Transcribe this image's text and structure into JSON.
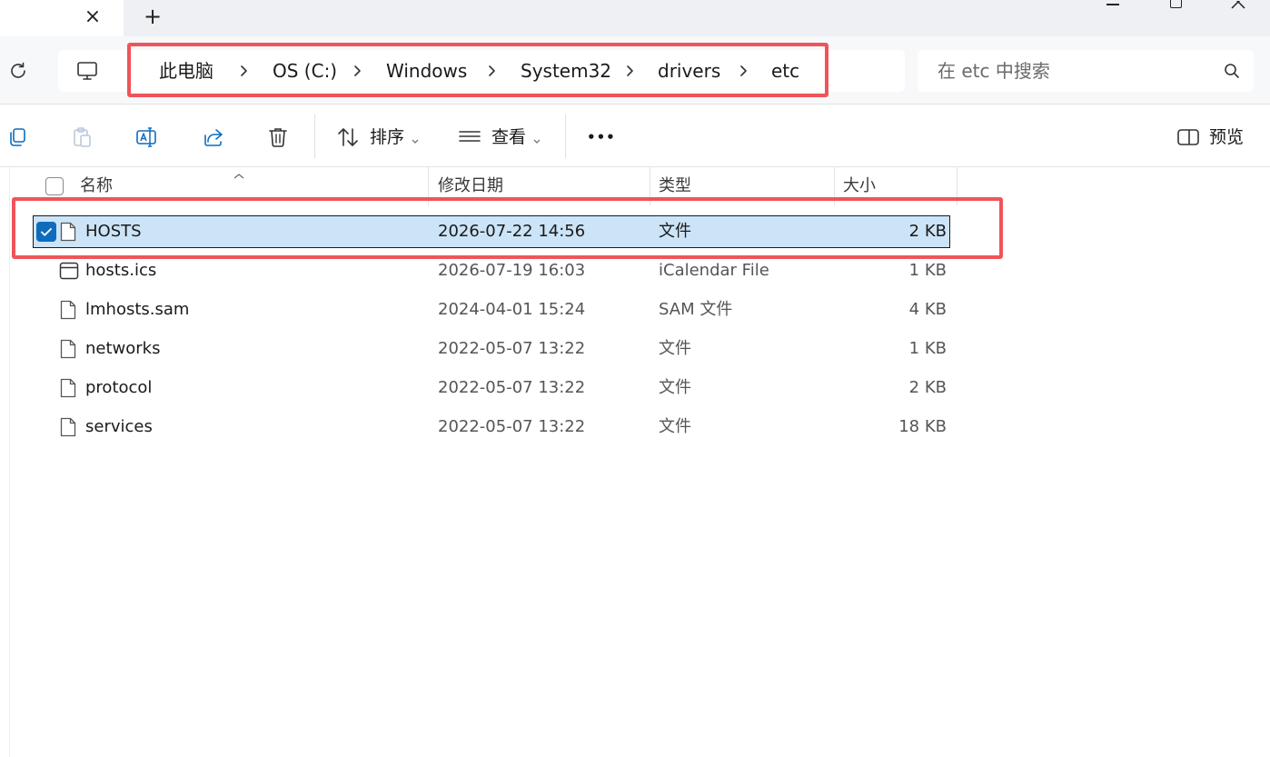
{
  "window": {
    "new_tab_symbol": "+",
    "close_tab_symbol": "×"
  },
  "address": {
    "breadcrumbs": [
      "此电脑",
      "OS (C:)",
      "Windows",
      "System32",
      "drivers",
      "etc"
    ],
    "search_placeholder": "在 etc 中搜索"
  },
  "toolbar": {
    "sort_label": "排序",
    "view_label": "查看",
    "more_label": "•••",
    "preview_label": "预览"
  },
  "columns": {
    "name": "名称",
    "modified": "修改日期",
    "type": "类型",
    "size": "大小"
  },
  "files": [
    {
      "name": "HOSTS",
      "modified": "2026-07-22 14:56",
      "type": "文件",
      "size": "2 KB",
      "icon": "file-icon",
      "selected": true
    },
    {
      "name": "hosts.ics",
      "modified": "2026-07-19 16:03",
      "type": "iCalendar File",
      "size": "1 KB",
      "icon": "calendar-file-icon",
      "selected": false
    },
    {
      "name": "lmhosts.sam",
      "modified": "2024-04-01 15:24",
      "type": "SAM 文件",
      "size": "4 KB",
      "icon": "file-icon",
      "selected": false
    },
    {
      "name": "networks",
      "modified": "2022-05-07 13:22",
      "type": "文件",
      "size": "1 KB",
      "icon": "file-icon",
      "selected": false
    },
    {
      "name": "protocol",
      "modified": "2022-05-07 13:22",
      "type": "文件",
      "size": "2 KB",
      "icon": "file-icon",
      "selected": false
    },
    {
      "name": "services",
      "modified": "2022-05-07 13:22",
      "type": "文件",
      "size": "18 KB",
      "icon": "file-icon",
      "selected": false
    }
  ],
  "colors": {
    "highlight": "#f0545a",
    "selection": "#cce4f7",
    "accent": "#0f6cbd"
  }
}
